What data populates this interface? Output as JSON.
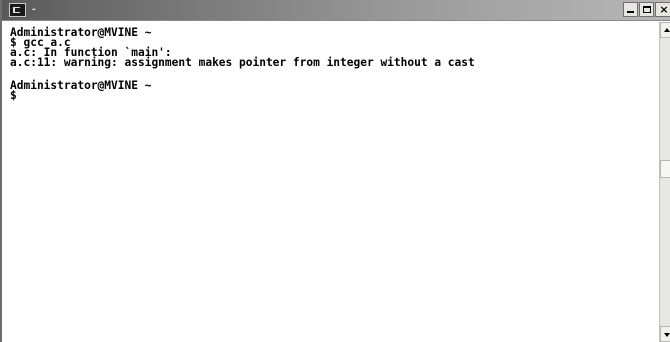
{
  "window": {
    "title": "-",
    "icon": "console-icon",
    "controls": {
      "minimize": "minimize-icon",
      "maximize": "maximize-icon",
      "close": "×"
    }
  },
  "console": {
    "lines": [
      "Administrator@MVINE ~",
      "$ gcc a.c",
      "a.c: In function `main':",
      "a.c:11: warning: assignment makes pointer from integer without a cast",
      "",
      "Administrator@MVINE ~",
      "$"
    ]
  },
  "scrollbar": {
    "up": "scroll-up-arrow-icon",
    "down": "scroll-down-arrow-icon"
  }
}
